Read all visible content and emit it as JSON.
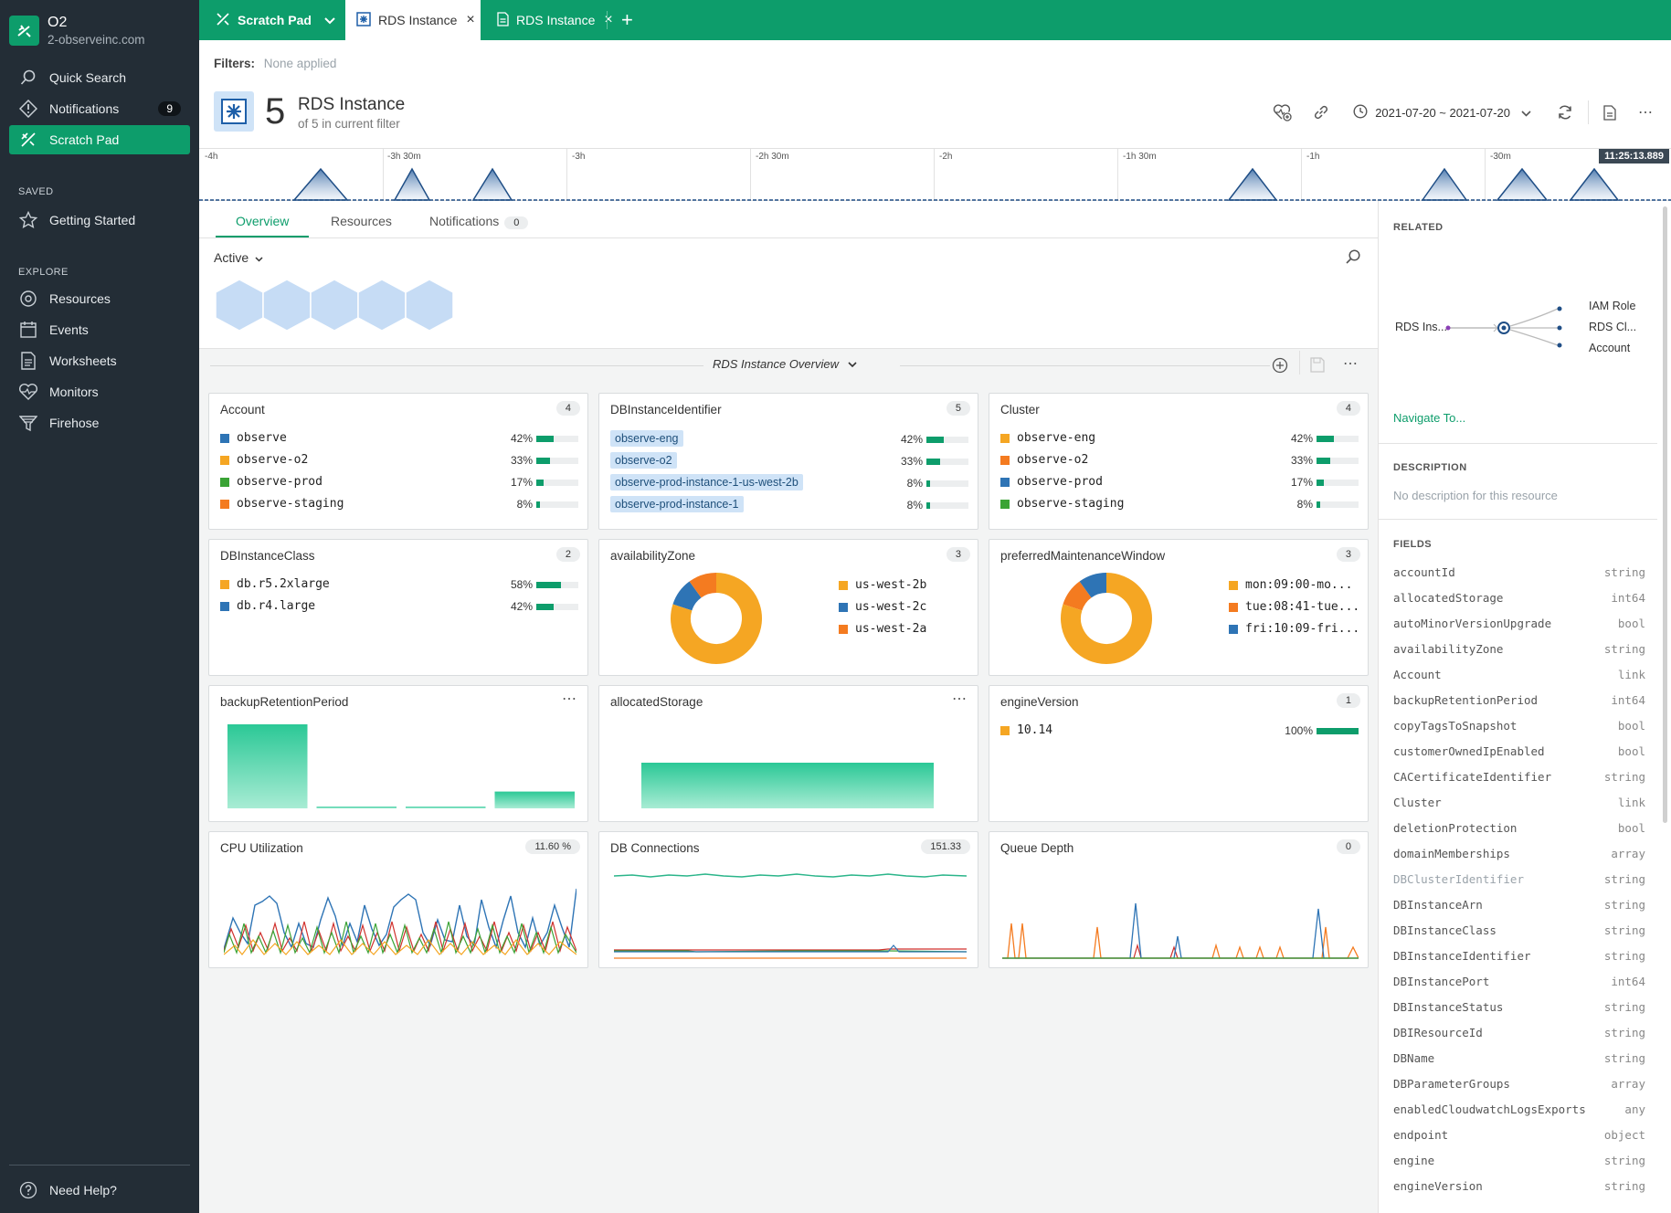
{
  "workspace": {
    "name": "O2",
    "domain": "2-observeinc.com"
  },
  "sidebar": {
    "quick_search": "Quick Search",
    "notifications": "Notifications",
    "notifications_count": "9",
    "scratch_pad": "Scratch Pad",
    "saved_heading": "SAVED",
    "getting_started": "Getting Started",
    "explore_heading": "EXPLORE",
    "explore": [
      "Resources",
      "Events",
      "Worksheets",
      "Monitors",
      "Firehose"
    ],
    "help": "Need Help?"
  },
  "tabs": [
    {
      "label": "Scratch Pad"
    },
    {
      "label": "RDS Instance"
    },
    {
      "label": "RDS Instance"
    }
  ],
  "filters": {
    "label": "Filters:",
    "value": "None applied"
  },
  "header": {
    "count": "5",
    "title": "RDS Instance",
    "subtitle": "of 5 in current filter",
    "date_range": "2021-07-20 ~ 2021-07-20"
  },
  "timeline": {
    "ticks": [
      "-4h",
      "-3h 30m",
      "-3h",
      "-2h 30m",
      "-2h",
      "-1h 30m",
      "-1h",
      "-30m"
    ],
    "current_time": "11:25:13.889"
  },
  "main_tabs": {
    "overview": "Overview",
    "resources": "Resources",
    "notifications": "Notifications",
    "notifications_count": "0"
  },
  "state_filter": "Active",
  "overview_title": "RDS Instance Overview",
  "colors": {
    "accent": "#0d9d6b",
    "orange": "#f5a623",
    "blue": "#2e74b5",
    "green": "#3aa335",
    "darkorange": "#f47b20",
    "red": "#d0312d"
  },
  "cards": {
    "account": {
      "title": "Account",
      "badge": "4",
      "rows": [
        {
          "label": "observe",
          "pct": "42%",
          "value": 42,
          "color": "#2e74b5"
        },
        {
          "label": "observe-o2",
          "pct": "33%",
          "value": 33,
          "color": "#f5a623"
        },
        {
          "label": "observe-prod",
          "pct": "17%",
          "value": 17,
          "color": "#3aa335"
        },
        {
          "label": "observe-staging",
          "pct": "8%",
          "value": 8,
          "color": "#f47b20"
        }
      ]
    },
    "dbinstanceidentifier": {
      "title": "DBInstanceIdentifier",
      "badge": "5",
      "rows": [
        {
          "label": "observe-eng",
          "pct": "42%",
          "value": 42
        },
        {
          "label": "observe-o2",
          "pct": "33%",
          "value": 33
        },
        {
          "label": "observe-prod-instance-1-us-west-2b",
          "pct": "8%",
          "value": 8
        },
        {
          "label": "observe-prod-instance-1",
          "pct": "8%",
          "value": 8
        }
      ]
    },
    "cluster": {
      "title": "Cluster",
      "badge": "4",
      "rows": [
        {
          "label": "observe-eng",
          "pct": "42%",
          "value": 42,
          "color": "#f5a623"
        },
        {
          "label": "observe-o2",
          "pct": "33%",
          "value": 33,
          "color": "#f47b20"
        },
        {
          "label": "observe-prod",
          "pct": "17%",
          "value": 17,
          "color": "#2e74b5"
        },
        {
          "label": "observe-staging",
          "pct": "8%",
          "value": 8,
          "color": "#3aa335"
        }
      ]
    },
    "dbinstanceclass": {
      "title": "DBInstanceClass",
      "badge": "2",
      "rows": [
        {
          "label": "db.r5.2xlarge",
          "pct": "58%",
          "value": 58,
          "color": "#f5a623"
        },
        {
          "label": "db.r4.large",
          "pct": "42%",
          "value": 42,
          "color": "#2e74b5"
        }
      ]
    },
    "availabilityzone": {
      "title": "availabilityZone",
      "badge": "3",
      "legend": [
        "us-west-2b",
        "us-west-2c",
        "us-west-2a"
      ]
    },
    "maintenance": {
      "title": "preferredMaintenanceWindow",
      "badge": "3",
      "legend": [
        "mon:09:00-mo...",
        "tue:08:41-tue...",
        "fri:10:09-fri..."
      ]
    },
    "backup": {
      "title": "backupRetentionPeriod"
    },
    "allocated": {
      "title": "allocatedStorage"
    },
    "engine": {
      "title": "engineVersion",
      "badge": "1",
      "rows": [
        {
          "label": "10.14",
          "pct": "100%",
          "value": 100,
          "color": "#f5a623"
        }
      ]
    },
    "cpu": {
      "title": "CPU Utilization",
      "badge": "11.60 %"
    },
    "dbconn": {
      "title": "DB Connections",
      "badge": "151.33"
    },
    "queue": {
      "title": "Queue Depth",
      "badge": "0"
    }
  },
  "chart_data": [
    {
      "type": "pie",
      "title": "availabilityZone",
      "labels": [
        "us-west-2b",
        "us-west-2c",
        "us-west-2a"
      ],
      "values": [
        80,
        10,
        10
      ],
      "colors": [
        "#f5a623",
        "#2e74b5",
        "#f47b20"
      ]
    },
    {
      "type": "pie",
      "title": "preferredMaintenanceWindow",
      "labels": [
        "mon:09:00-mo...",
        "tue:08:41-tue...",
        "fri:10:09-fri..."
      ],
      "values": [
        80,
        10,
        10
      ],
      "colors": [
        "#f5a623",
        "#f47b20",
        "#2e74b5"
      ]
    },
    {
      "type": "bar",
      "title": "backupRetentionPeriod",
      "values": [
        100,
        2,
        2,
        20
      ]
    },
    {
      "type": "bar",
      "title": "allocatedStorage",
      "values": [
        100
      ]
    }
  ],
  "related": {
    "heading": "RELATED",
    "source": "RDS Ins...",
    "targets": [
      "IAM Role",
      "RDS Cl...",
      "Account"
    ],
    "navigate": "Navigate To..."
  },
  "description": {
    "heading": "DESCRIPTION",
    "text": "No description for this resource"
  },
  "fields": {
    "heading": "FIELDS",
    "items": [
      {
        "name": "accountId",
        "type": "string"
      },
      {
        "name": "allocatedStorage",
        "type": "int64"
      },
      {
        "name": "autoMinorVersionUpgrade",
        "type": "bool"
      },
      {
        "name": "availabilityZone",
        "type": "string"
      },
      {
        "name": "Account",
        "type": "link"
      },
      {
        "name": "backupRetentionPeriod",
        "type": "int64"
      },
      {
        "name": "copyTagsToSnapshot",
        "type": "bool"
      },
      {
        "name": "customerOwnedIpEnabled",
        "type": "bool"
      },
      {
        "name": "CACertificateIdentifier",
        "type": "string"
      },
      {
        "name": "Cluster",
        "type": "link"
      },
      {
        "name": "deletionProtection",
        "type": "bool"
      },
      {
        "name": "domainMemberships",
        "type": "array"
      },
      {
        "name": "DBClusterIdentifier",
        "type": "string"
      },
      {
        "name": "DBInstanceArn",
        "type": "string"
      },
      {
        "name": "DBInstanceClass",
        "type": "string"
      },
      {
        "name": "DBInstanceIdentifier",
        "type": "string"
      },
      {
        "name": "DBInstancePort",
        "type": "int64"
      },
      {
        "name": "DBInstanceStatus",
        "type": "string"
      },
      {
        "name": "DBIResourceId",
        "type": "string"
      },
      {
        "name": "DBName",
        "type": "string"
      },
      {
        "name": "DBParameterGroups",
        "type": "array"
      },
      {
        "name": "enabledCloudwatchLogsExports",
        "type": "any"
      },
      {
        "name": "endpoint",
        "type": "object"
      },
      {
        "name": "engine",
        "type": "string"
      },
      {
        "name": "engineVersion",
        "type": "string"
      }
    ]
  }
}
